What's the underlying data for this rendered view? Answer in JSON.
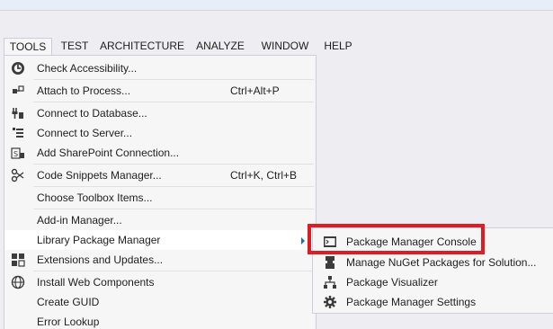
{
  "menubar": {
    "items": [
      {
        "label": "TOOLS",
        "open": true
      },
      {
        "label": "TEST"
      },
      {
        "label": "ARCHITECTURE"
      },
      {
        "label": "ANALYZE"
      },
      {
        "label": "WINDOW"
      },
      {
        "label": "HELP"
      }
    ]
  },
  "tools_menu": {
    "items": [
      {
        "label": "Check Accessibility...",
        "icon": "accessibility-icon"
      },
      {
        "label": "Attach to Process...",
        "shortcut": "Ctrl+Alt+P",
        "icon": "attach-process-icon"
      },
      {
        "label": "Connect to Database...",
        "icon": "database-plug-icon"
      },
      {
        "label": "Connect to Server...",
        "icon": "server-icon"
      },
      {
        "label": "Add SharePoint Connection...",
        "icon": "sharepoint-icon"
      },
      {
        "label": "Code Snippets Manager...",
        "shortcut": "Ctrl+K, Ctrl+B",
        "icon": "snippets-icon"
      },
      {
        "label": "Choose Toolbox Items..."
      },
      {
        "label": "Add-in Manager..."
      },
      {
        "label": "Library Package Manager",
        "has_submenu": true
      },
      {
        "label": "Extensions and Updates...",
        "icon": "extensions-icon"
      },
      {
        "label": "Install Web Components",
        "icon": "globe-icon"
      },
      {
        "label": "Create GUID"
      },
      {
        "label": "Error Lookup"
      }
    ]
  },
  "submenu": {
    "items": [
      {
        "label": "Package Manager Console",
        "icon": "console-icon",
        "highlighted": true
      },
      {
        "label": "Manage NuGet Packages for Solution...",
        "icon": "nuget-icon"
      },
      {
        "label": "Package Visualizer",
        "icon": "hierarchy-icon"
      },
      {
        "label": "Package Manager Settings",
        "icon": "gear-icon"
      }
    ]
  },
  "colors": {
    "highlight_border": "#e01b24",
    "menu_bg": "#f6f6f6",
    "hover_bg": "#ffffff",
    "arrow": "#1e6fb8"
  }
}
